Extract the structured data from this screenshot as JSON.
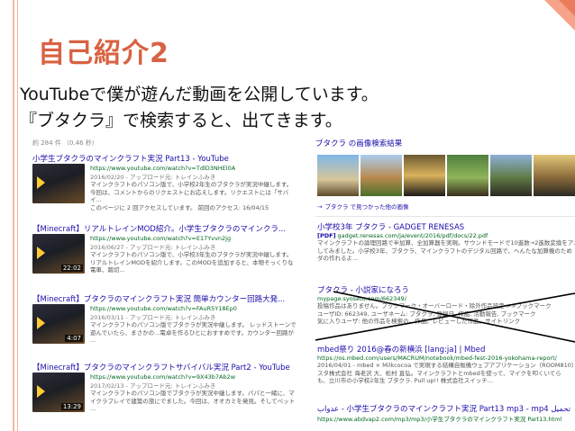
{
  "slide": {
    "title": "自己紹介2",
    "line1": "YouTubeで僕が遊んだ動画を公開しています。",
    "line2": "『ブタクラ』で検索すると、出てきます。"
  },
  "search": {
    "count": "約 284 件 （0.46 秒）",
    "video_results": [
      {
        "title": "小学生ブタクラのマインクラフト実況 Part13 - YouTube",
        "url": "https://www.youtube.com/watch?v=TdlD3NHEl0A",
        "date": "2016/02/20 - アップロード元: トレインふみき",
        "snippet": [
          "マインクラフトのパソコン版で、小学校2年生のブタクラが実況中継します。",
          "今回は、コメントからのリクエストにお応えします。リクエストには「サバ",
          "イ...",
          "このページに 2 回アクセスしています。 前回のアクセス: 16/04/15"
        ],
        "duration": ""
      },
      {
        "title": "【Minecraft】リアルトレインMOD紹介。小学生ブタクラのマインクラ...",
        "url": "https://www.youtube.com/watch?v=E17Yvvn2jg",
        "date": "2016/06/27 - アップロード元: トレインふみき",
        "snippet": [
          "マインクラフトのパソコン版で、小学校3年生のブタクラが実況中継します。",
          "リアルトレインMODを紹介します。このMODを追加すると、本物そっくりな",
          "電車、踏切..."
        ],
        "duration": "22:02"
      },
      {
        "title": "【Minecraft】ブタクラのマインクラフト実況 簡単カウンター回路大発...",
        "url": "https://www.youtube.com/watch?v=FAuR5Y18Ep0",
        "date": "2016/03/11 - アップロード元: トレインふみき",
        "snippet": [
          "マインクラフトのパソコン版でブタクラが実況中継します。 レッドストーンで",
          "遊んでいたら、まさかの...電卓を作るひとにおすすめです。カウンター回路が",
          "..."
        ],
        "duration": "4:07"
      },
      {
        "title": "【Minecraft】ブタクラのマインクラフトサバイバル実況 Part2 - YouTube",
        "url": "https://www.youtube.com/watch?v=9X43b7Ab2w",
        "date": "2017/02/13 - アップロード元: トレインふみき",
        "snippet": [
          "マインクラフトのパソコン版でブタクラが実況中継します。パパと一緒に、マ",
          "イクラプレイで建築の旅にでました。今回は、オオカミを発見。そしてペット",
          "..."
        ],
        "duration": "13:29"
      }
    ],
    "images_heading": "ブタクラ の画像検索結果",
    "images_more": "ブタクラ で見つかった他の画像",
    "right_results": [
      {
        "title": "小学校3年 ブタクラ - GADGET RENESAS",
        "pdf": "[PDF]",
        "url": "gadget.renesas.com/ja/event/2016/pdf/docs/22.pdf",
        "snippet": [
          "マインクラフトの論理回路で半加算、全加算器を実現。サウンドモードで10進数→2進数変換をアニメーシ",
          "してみました。小学校3年、ブタクラ、マインクラフトのデジタル回路で、ヘんたな加算機のため",
          "ダの作れるよ..."
        ]
      },
      {
        "title": "ブタクラ - 小説家になろう",
        "pdf": "",
        "url": "mypage.syosetu.com/662349/",
        "snippet": [
          "投稿作品はありません。ブックマーク・オーバーロード・除外作品設定 >>ブックマーク",
          "ユーザID: 662349, ユーザネーム: ブタクラ, 登録日, 作品, 活動報告, ブックマーク",
          "気に入りユーザ: 他の作品を検索の。作品。レビューした作品。サイトリンク"
        ]
      },
      {
        "title": "mbed祭り 2016@春の新横浜 [lang:ja] | Mbed",
        "pdf": "",
        "url": "https://os.mbed.com/users/MACRUM/notebook/mbed-fest-2016-yokohama-report/",
        "snippet": [
          "2016/04/01 - mbed × Milkcocoa で実現する結構自販機ウェブアプリケーション（ROOM810）| ",
          "スタ株式会社 海老沢 大、松村 直弘。マインクラフトとmbedを使って、マイクを叩くいてら",
          "も、立川市の小学校2年生 ブタクラ. Pull up!! 株式会社スイッチ..."
        ]
      },
      {
        "title": "عدواب - 小学生ブタクラのマインクラフト実況 Part13 mp3 - mp4 تحميل",
        "pdf": "",
        "url": "https://www.abdvap2.com/mp3/mp3/小学生ブタクラのマインクラフト実況 Part13.html",
        "snippet": []
      }
    ]
  }
}
